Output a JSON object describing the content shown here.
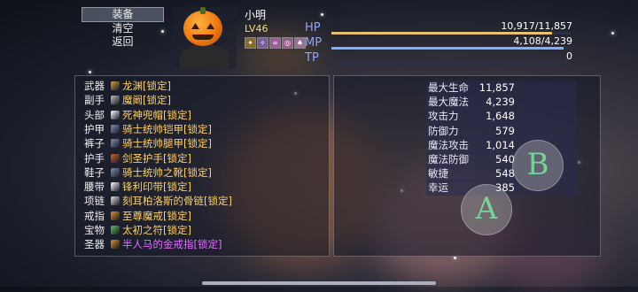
{
  "menu": {
    "items": [
      "装备",
      "清空",
      "返回"
    ],
    "selected_index": 0
  },
  "character": {
    "name": "小明",
    "level": "LV46",
    "status_icons": [
      "buff-icon-1",
      "buff-icon-2",
      "buff-icon-3",
      "buff-icon-4",
      "buff-icon-5"
    ]
  },
  "bars": [
    {
      "label": "HP",
      "value": "10,917/11,857",
      "fraction": 0.9207,
      "color": "#e8c070"
    },
    {
      "label": "MP",
      "value": "4,108/4,239",
      "fraction": 0.9691,
      "color": "#7ab0ff"
    },
    {
      "label": "TP",
      "value": "0",
      "fraction": 0,
      "color": "#80e080"
    }
  ],
  "equipment": [
    {
      "slot": "武器",
      "item": "龙渊[锁定]",
      "icon": "sword-icon",
      "icon_color": "#d0a040",
      "style": "yellow"
    },
    {
      "slot": "副手",
      "item": "魔阚[锁定]",
      "icon": "dagger-icon",
      "icon_color": "#c0c0c0",
      "style": "yellow"
    },
    {
      "slot": "头部",
      "item": "死神兜帽[锁定]",
      "icon": "hood-icon",
      "icon_color": "#ffffff",
      "style": "yellow"
    },
    {
      "slot": "护甲",
      "item": "骑士统帅铠甲[锁定]",
      "icon": "armor-icon",
      "icon_color": "#8090b0",
      "style": "yellow"
    },
    {
      "slot": "裤子",
      "item": "骑士统帅腿甲[锁定]",
      "icon": "legs-icon",
      "icon_color": "#8090b0",
      "style": "yellow"
    },
    {
      "slot": "护手",
      "item": "剑圣护手[锁定]",
      "icon": "gauntlet-icon",
      "icon_color": "#d06030",
      "style": "yellow"
    },
    {
      "slot": "鞋子",
      "item": "骑士统帅之靴[锁定]",
      "icon": "boots-icon",
      "icon_color": "#8090b0",
      "style": "yellow"
    },
    {
      "slot": "腰带",
      "item": "锋利印带[锁定]",
      "icon": "belt-icon",
      "icon_color": "#ffffff",
      "style": "yellow"
    },
    {
      "slot": "项链",
      "item": "刻耳柏洛斯的骨链[锁定]",
      "icon": "necklace-icon",
      "icon_color": "#e0e0e0",
      "style": "yellow"
    },
    {
      "slot": "戒指",
      "item": "至尊魔戒[锁定]",
      "icon": "ring-icon",
      "icon_color": "#e09030",
      "style": "yellow"
    },
    {
      "slot": "宝物",
      "item": "太初之符[锁定]",
      "icon": "charm-icon",
      "icon_color": "#60c060",
      "style": "yellow"
    },
    {
      "slot": "圣器",
      "item": "半人马的金戒指[锁定]",
      "icon": "gold-ring-icon",
      "icon_color": "#e09030",
      "style": "purple"
    }
  ],
  "stats": [
    {
      "name": "最大生命",
      "value": "11,857"
    },
    {
      "name": "最大魔法",
      "value": "4,239"
    },
    {
      "name": "攻击力",
      "value": "1,648"
    },
    {
      "name": "防御力",
      "value": "579"
    },
    {
      "name": "魔法攻击",
      "value": "1,014"
    },
    {
      "name": "魔法防御",
      "value": "540"
    },
    {
      "name": "敏捷",
      "value": "548"
    },
    {
      "name": "幸运",
      "value": "385"
    }
  ],
  "buttons": {
    "b_label": "B",
    "a_label": "A"
  }
}
